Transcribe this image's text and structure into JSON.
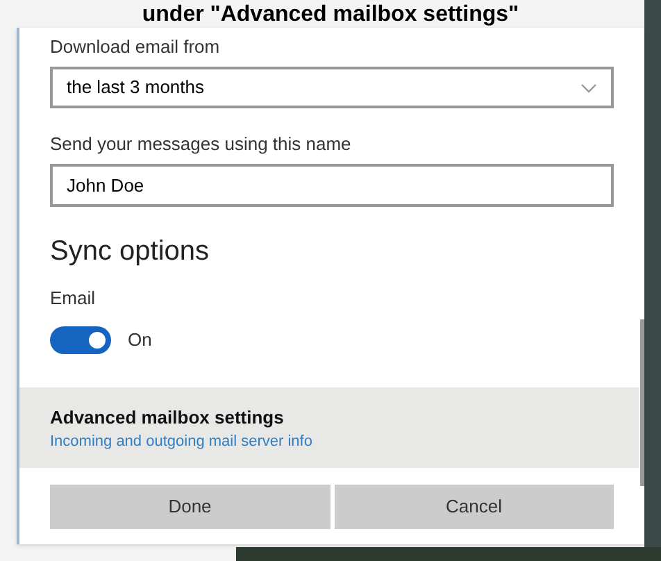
{
  "caption": "under \"Advanced mailbox settings\"",
  "download": {
    "label": "Download email from",
    "value": "the last 3 months"
  },
  "send_name": {
    "label": "Send your messages using this name",
    "value": "John Doe"
  },
  "sync": {
    "heading": "Sync options",
    "label": "Email",
    "on": true,
    "state_text": "On"
  },
  "advanced": {
    "title": "Advanced mailbox settings",
    "link": "Incoming and outgoing mail server info"
  },
  "buttons": [
    "Done",
    "Cancel"
  ]
}
